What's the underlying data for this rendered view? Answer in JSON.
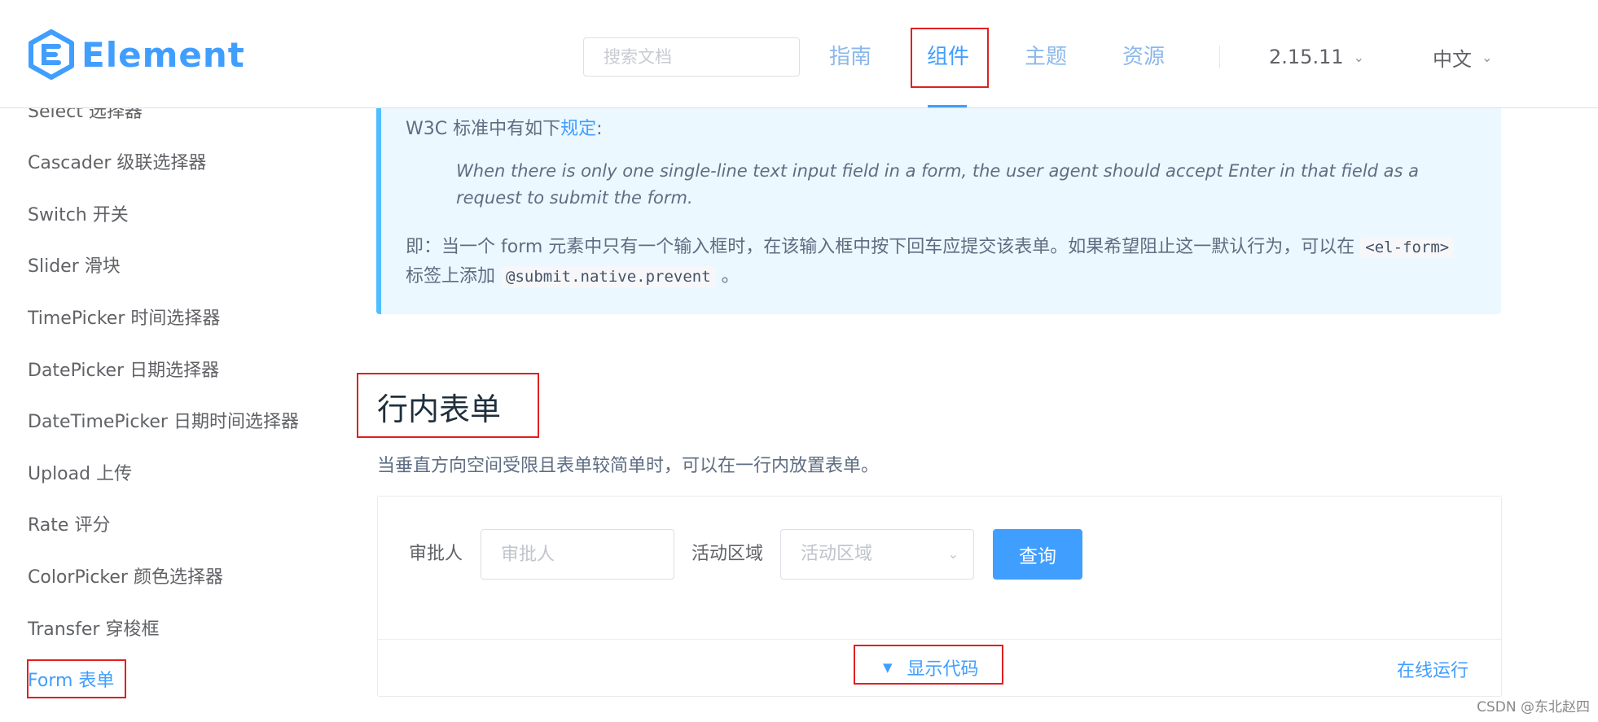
{
  "header": {
    "logo_text": "Element",
    "search_placeholder": "搜索文档",
    "nav": [
      {
        "label": "指南"
      },
      {
        "label": "组件"
      },
      {
        "label": "主题"
      },
      {
        "label": "资源"
      }
    ],
    "version": "2.15.11",
    "language": "中文"
  },
  "sidebar": {
    "items": [
      {
        "label": "Select 选择器"
      },
      {
        "label": "Cascader 级联选择器"
      },
      {
        "label": "Switch 开关"
      },
      {
        "label": "Slider 滑块"
      },
      {
        "label": "TimePicker 时间选择器"
      },
      {
        "label": "DatePicker 日期选择器"
      },
      {
        "label": "DateTimePicker 日期时间选择器"
      },
      {
        "label": "Upload 上传"
      },
      {
        "label": "Rate 评分"
      },
      {
        "label": "ColorPicker 颜色选择器"
      },
      {
        "label": "Transfer 穿梭框"
      },
      {
        "label": "Form 表单"
      }
    ]
  },
  "tip": {
    "intro_prefix": "W3C 标准中有如下",
    "intro_link": "规定",
    "intro_suffix": ":",
    "quote": "When there is only one single-line text input field in a form, the user agent should accept Enter in that field as a request to submit the form.",
    "para_prefix": "即：当一个 form 元素中只有一个输入框时，在该输入框中按下回车应提交该表单。如果希望阻止这一默认行为，可以在",
    "para_code1": "<el-form>",
    "para_mid": "标签上添加",
    "para_code2": "@submit.native.prevent",
    "para_suffix": "。"
  },
  "section": {
    "title": "行内表单",
    "description": "当垂直方向空间受限且表单较简单时，可以在一行内放置表单。"
  },
  "demo": {
    "approver_label": "审批人",
    "approver_placeholder": "审批人",
    "region_label": "活动区域",
    "region_placeholder": "活动区域",
    "query_button": "查询",
    "show_code": "显示代码",
    "run_online": "在线运行"
  },
  "watermark": "CSDN @东北赵四",
  "colors": {
    "primary": "#409eff",
    "highlight_box": "#e02020"
  }
}
